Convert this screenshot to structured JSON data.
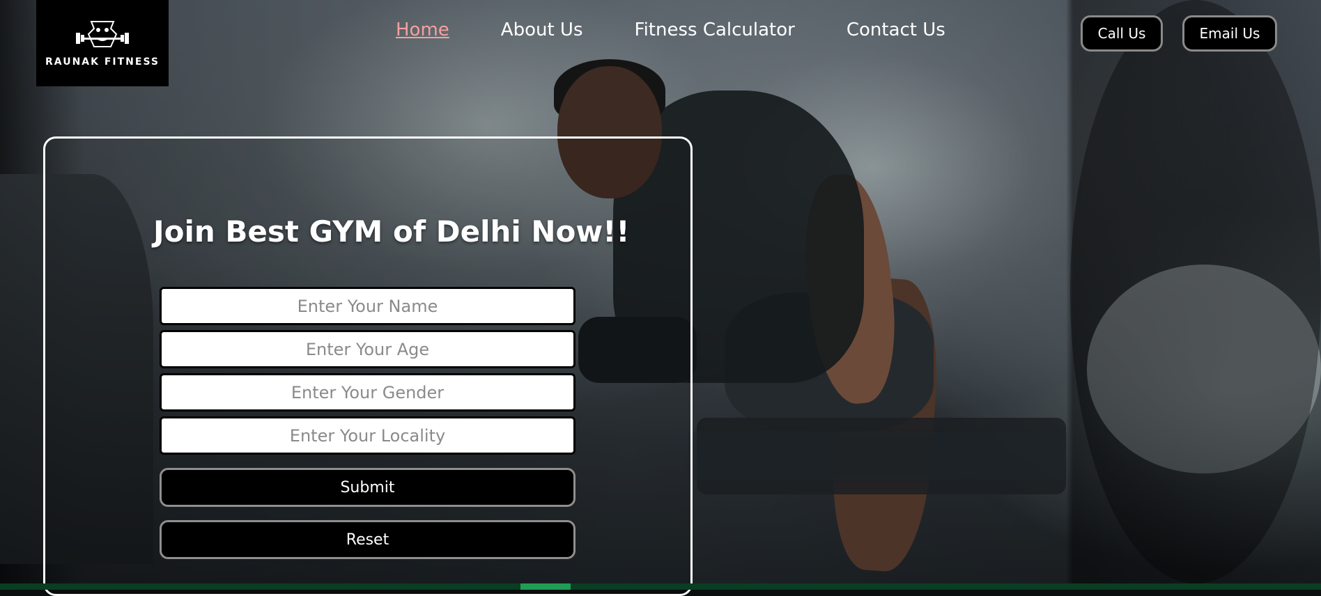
{
  "brand": {
    "name": "RAUNAK FITNESS"
  },
  "nav": {
    "items": [
      {
        "label": "Home",
        "active": true
      },
      {
        "label": "About Us",
        "active": false
      },
      {
        "label": "Fitness Calculator",
        "active": false
      },
      {
        "label": "Contact Us",
        "active": false
      }
    ],
    "call_label": "Call Us",
    "email_label": "Email Us"
  },
  "form": {
    "headline": "Join Best GYM of Delhi Now!!",
    "fields": {
      "name_placeholder": "Enter Your Name",
      "age_placeholder": "Enter Your Age",
      "gender_placeholder": "Enter Your Gender",
      "locality_placeholder": "Enter Your Locality"
    },
    "submit_label": "Submit",
    "reset_label": "Reset"
  },
  "colors": {
    "active_link": "#f4a0a0",
    "button_bg": "#000000",
    "scrollbar_track": "#0a3d22",
    "scrollbar_thumb": "#1f9d55"
  },
  "icons": {
    "logo": "gym-mascot-icon"
  }
}
